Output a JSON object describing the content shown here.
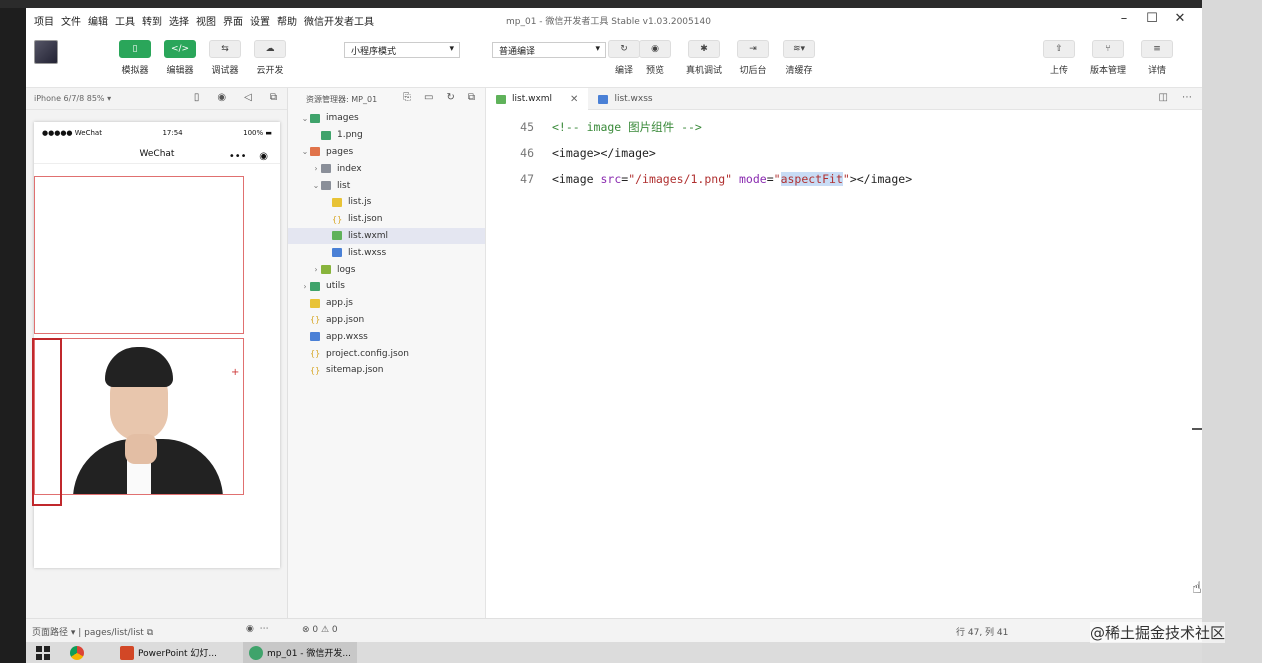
{
  "menubar": {
    "items": [
      "项目",
      "文件",
      "编辑",
      "工具",
      "转到",
      "选择",
      "视图",
      "界面",
      "设置",
      "帮助",
      "微信开发者工具"
    ],
    "title": "mp_01 - 微信开发者工具 Stable v1.03.2005140"
  },
  "toolbar": {
    "simulator": "模拟器",
    "editor": "编辑器",
    "debugger": "调试器",
    "cloud": "云开发",
    "mode_select": "小程序模式",
    "compile_select": "普通编译",
    "compile": "编译",
    "preview": "预览",
    "real_debug": "真机调试",
    "background": "切后台",
    "clear_cache": "清缓存",
    "upload": "上传",
    "version": "版本管理",
    "details": "详情"
  },
  "simulator": {
    "device": "iPhone 6/7/8 85%",
    "carrier": "●●●●● WeChat",
    "time": "17:54",
    "battery": "100%",
    "nav_title": "WeChat"
  },
  "explorer": {
    "title": "资源管理器",
    "project": "MP_01",
    "tree": [
      {
        "label": "images",
        "type": "img",
        "depth": 0,
        "twisty": "v"
      },
      {
        "label": "1.png",
        "type": "img",
        "depth": 1,
        "twisty": ""
      },
      {
        "label": "pages",
        "type": "pages",
        "depth": 0,
        "twisty": "v"
      },
      {
        "label": "index",
        "type": "folder",
        "depth": 1,
        "twisty": ">"
      },
      {
        "label": "list",
        "type": "folder",
        "depth": 1,
        "twisty": "v"
      },
      {
        "label": "list.js",
        "type": "js",
        "depth": 2,
        "twisty": ""
      },
      {
        "label": "list.json",
        "type": "json",
        "depth": 2,
        "twisty": ""
      },
      {
        "label": "list.wxml",
        "type": "wxml",
        "depth": 2,
        "twisty": "",
        "active": true
      },
      {
        "label": "list.wxss",
        "type": "wxss",
        "depth": 2,
        "twisty": ""
      },
      {
        "label": "logs",
        "type": "logs",
        "depth": 1,
        "twisty": ">"
      },
      {
        "label": "utils",
        "type": "utils",
        "depth": 0,
        "twisty": ">"
      },
      {
        "label": "app.js",
        "type": "js",
        "depth": 0,
        "twisty": ""
      },
      {
        "label": "app.json",
        "type": "json",
        "depth": 0,
        "twisty": ""
      },
      {
        "label": "app.wxss",
        "type": "wxss",
        "depth": 0,
        "twisty": ""
      },
      {
        "label": "project.config.json",
        "type": "json",
        "depth": 0,
        "twisty": ""
      },
      {
        "label": "sitemap.json",
        "type": "json",
        "depth": 0,
        "twisty": ""
      }
    ]
  },
  "editor": {
    "tabs": [
      {
        "label": "list.wxml",
        "active": true
      },
      {
        "label": "list.wxss",
        "active": false
      }
    ],
    "lines": [
      {
        "no": "45",
        "comment": "<!-- image 图片组件 -->"
      },
      {
        "no": "46",
        "text": "<image></image>"
      },
      {
        "no": "47",
        "pre": "<image ",
        "a1": "src",
        "eq1": "=",
        "v1": "\"/images/1.png\"",
        "sp": " ",
        "a2": "mode",
        "eq2": "=",
        "q1": "\"",
        "v2": "aspectFit",
        "q2": "\"",
        "post": "></image>"
      }
    ]
  },
  "statusbar": {
    "path_label": "页面路径",
    "path": "pages/list/list",
    "errors": "⊗ 0 ⚠ 0",
    "position": "行 47, 列 41"
  },
  "taskbar": {
    "ppt": "PowerPoint 幻灯...",
    "devtool": "mp_01 - 微信开发..."
  },
  "watermark": "@稀土掘金技术社区"
}
